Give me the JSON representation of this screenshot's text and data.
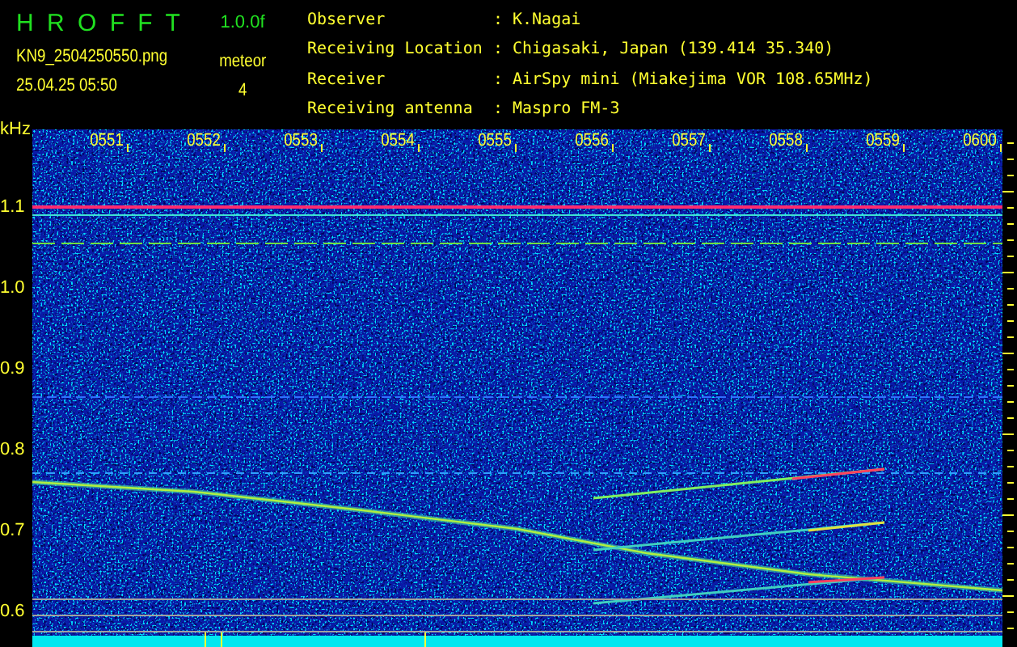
{
  "app": {
    "title": "H R O F F T",
    "version": "1.0.0f"
  },
  "file": {
    "name": "KN9_2504250550.png",
    "datetime": "25.04.25 05:50"
  },
  "detection": {
    "label": "meteor",
    "count": "4"
  },
  "station": [
    {
      "label": "Observer",
      "separator": ":",
      "value": "K.Nagai"
    },
    {
      "label": "Receiving Location",
      "separator": ":",
      "value": "Chigasaki, Japan (139.414 35.340)"
    },
    {
      "label": "Receiver",
      "separator": ":",
      "value": "AirSpy mini (Miakejima VOR 108.65MHz)"
    },
    {
      "label": "Receiving antenna",
      "separator": ":",
      "value": "Maspro FM-3"
    }
  ],
  "spectrogram": {
    "unit": "kHz",
    "y_labels": [
      "1.1",
      "1.0",
      "0.9",
      "0.8",
      "0.7",
      "0.6"
    ],
    "time_labels": [
      "0551",
      "0552",
      "0553",
      "0554",
      "0555",
      "0556",
      "0557",
      "0558",
      "0559",
      "0600"
    ]
  }
}
